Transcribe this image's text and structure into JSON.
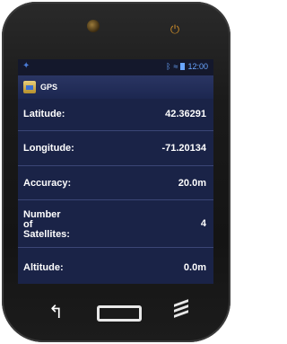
{
  "status_bar": {
    "left_icon": "usb-icon",
    "right_icons": [
      "bluetooth-icon",
      "wifi-icon",
      "battery-icon"
    ],
    "time": "12:00"
  },
  "app_bar": {
    "icon": "gps-app-icon",
    "title": "GPS"
  },
  "gps_fields": [
    {
      "label": "Latitude:",
      "value": "42.36291"
    },
    {
      "label": "Longitude:",
      "value": "-71.20134"
    },
    {
      "label": "Accuracy:",
      "value": "20.0m"
    },
    {
      "label": "Number\nof\nSatellites:",
      "value": "4"
    },
    {
      "label": "Altitude:",
      "value": "0.0m"
    }
  ],
  "nav_buttons": [
    "back-icon",
    "home-icon",
    "menu-icon"
  ],
  "colors": {
    "screen_bg": "#1a2347",
    "title_bar": "#2a3563",
    "accent": "#6aa6ff"
  }
}
